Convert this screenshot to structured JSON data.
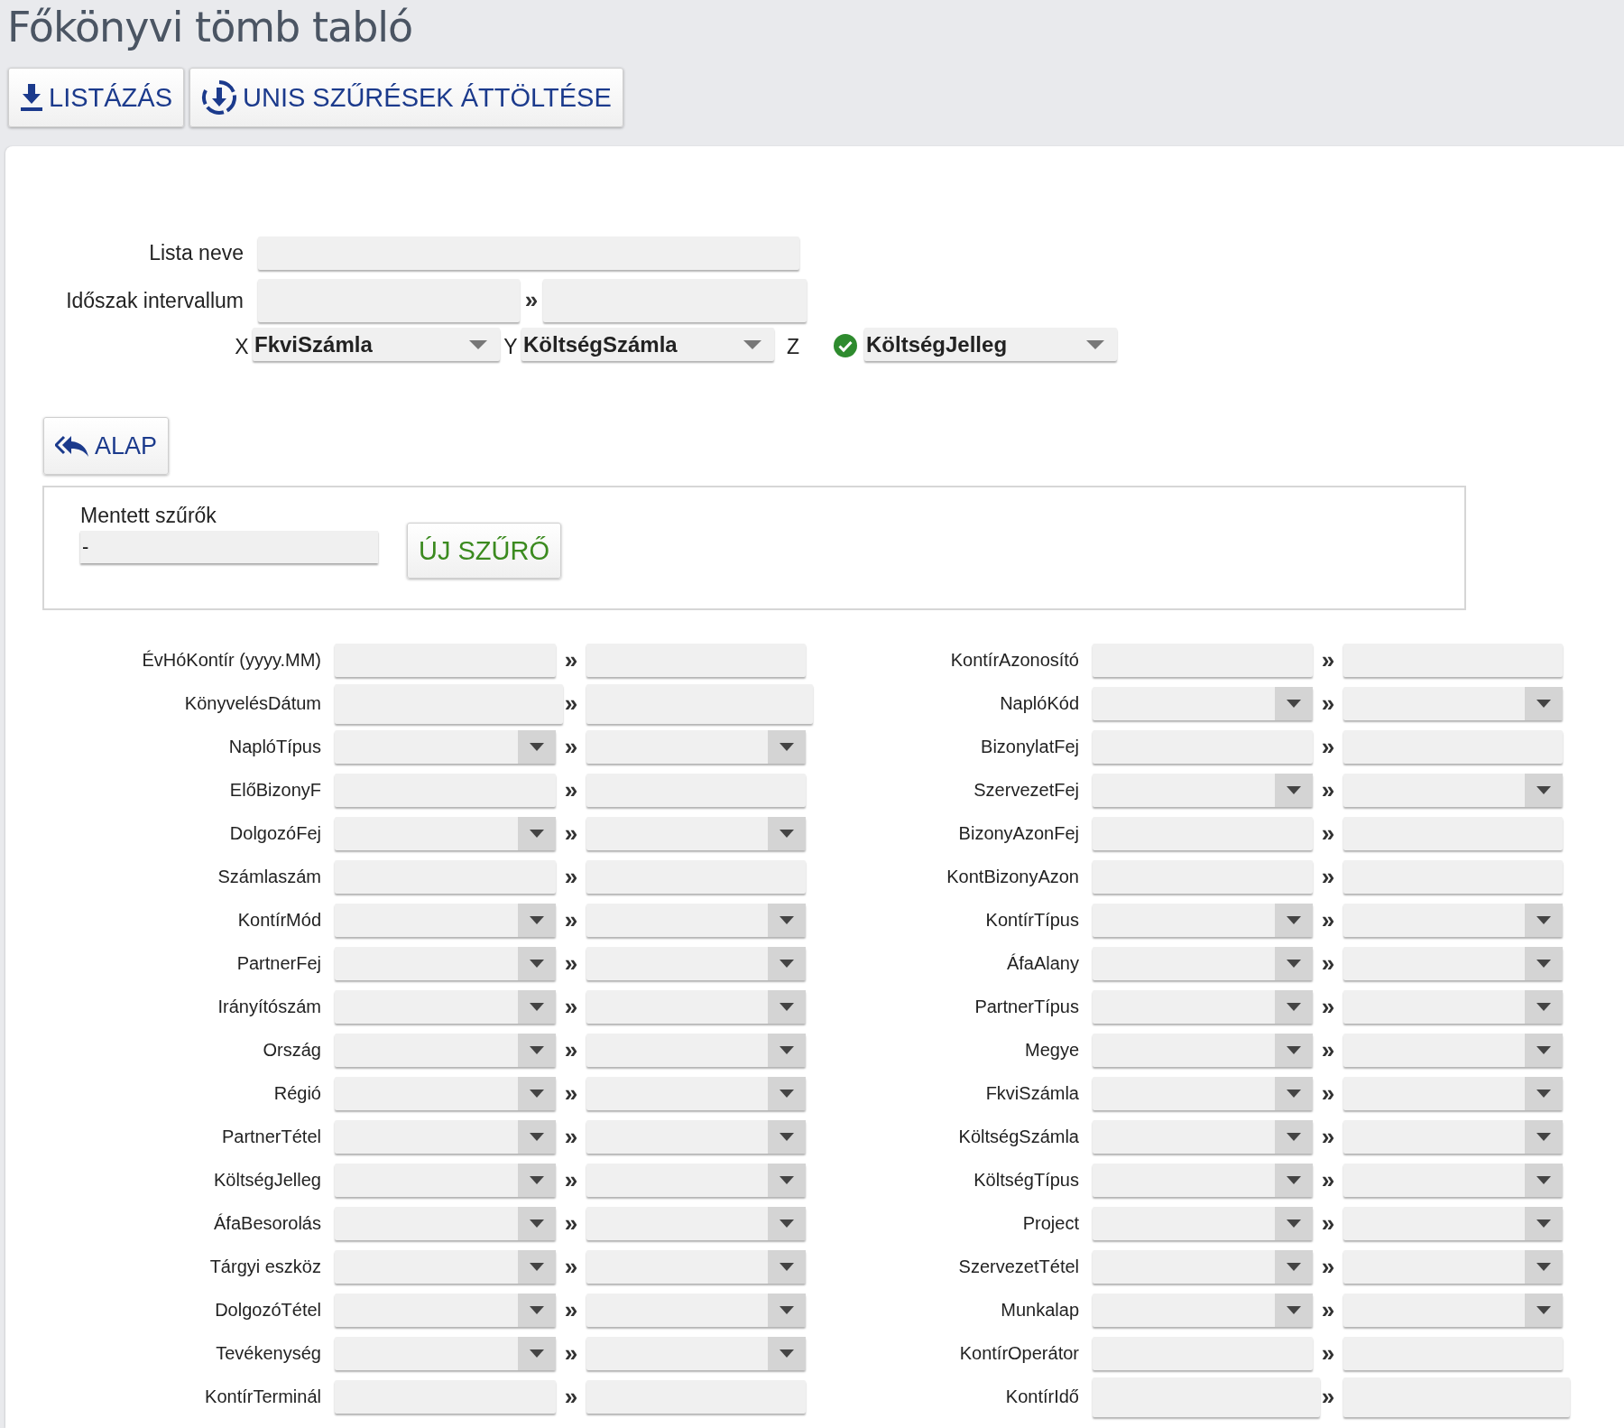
{
  "title": "Főkönyvi tömb tabló",
  "toolbar": [
    {
      "kind": "download",
      "label": "LISTÁZÁS"
    },
    {
      "kind": "import",
      "label": "UNIS SZŰRÉSEK ÁTTÖLTÉSE"
    }
  ],
  "form": {
    "list_name": {
      "label": "Lista neve"
    },
    "period": {
      "label": "Időszak intervallum",
      "separator": "»"
    },
    "axes": [
      {
        "label": "X",
        "value": "FkviSzámla",
        "checked": false
      },
      {
        "label": "Y",
        "value": "KöltségSzámla",
        "checked": false
      },
      {
        "label": "Z",
        "value": "KöltségJelleg",
        "checked": true
      }
    ]
  },
  "reset_button": {
    "label": "ALAP"
  },
  "saved_filters": {
    "label": "Mentett szűrők",
    "value": "-",
    "new_button": "ÚJ SZŰRŐ"
  },
  "filters_left": [
    {
      "label": "ÉvHóKontír (yyyy.MM)",
      "kind": "text"
    },
    {
      "label": "KönyvelésDátum",
      "kind": "date"
    },
    {
      "label": "NaplóTípus",
      "kind": "select"
    },
    {
      "label": "ElőBizonyF",
      "kind": "text"
    },
    {
      "label": "DolgozóFej",
      "kind": "select"
    },
    {
      "label": "Számlaszám",
      "kind": "text"
    },
    {
      "label": "KontírMód",
      "kind": "select"
    },
    {
      "label": "PartnerFej",
      "kind": "select"
    },
    {
      "label": "Irányítószám",
      "kind": "select"
    },
    {
      "label": "Ország",
      "kind": "select"
    },
    {
      "label": "Régió",
      "kind": "select"
    },
    {
      "label": "PartnerTétel",
      "kind": "select"
    },
    {
      "label": "KöltségJelleg",
      "kind": "select"
    },
    {
      "label": "ÁfaBesorolás",
      "kind": "select"
    },
    {
      "label": "Tárgyi eszköz",
      "kind": "select"
    },
    {
      "label": "DolgozóTétel",
      "kind": "select"
    },
    {
      "label": "Tevékenység",
      "kind": "select"
    },
    {
      "label": "KontírTerminál",
      "kind": "text"
    }
  ],
  "filters_right": [
    {
      "label": "KontírAzonosító",
      "kind": "text"
    },
    {
      "label": "NaplóKód",
      "kind": "select"
    },
    {
      "label": "BizonylatFej",
      "kind": "text"
    },
    {
      "label": "SzervezetFej",
      "kind": "select"
    },
    {
      "label": "BizonyAzonFej",
      "kind": "text"
    },
    {
      "label": "KontBizonyAzon",
      "kind": "text"
    },
    {
      "label": "KontírTípus",
      "kind": "select"
    },
    {
      "label": "ÁfaAlany",
      "kind": "select"
    },
    {
      "label": "PartnerTípus",
      "kind": "select"
    },
    {
      "label": "Megye",
      "kind": "select"
    },
    {
      "label": "FkviSzámla",
      "kind": "select"
    },
    {
      "label": "KöltségSzámla",
      "kind": "select"
    },
    {
      "label": "KöltségTípus",
      "kind": "select"
    },
    {
      "label": "Project",
      "kind": "select"
    },
    {
      "label": "SzervezetTétel",
      "kind": "select"
    },
    {
      "label": "Munkalap",
      "kind": "select"
    },
    {
      "label": "KontírOperátor",
      "kind": "text"
    },
    {
      "label": "KontírIdő",
      "kind": "date"
    }
  ],
  "range_separator": "»"
}
